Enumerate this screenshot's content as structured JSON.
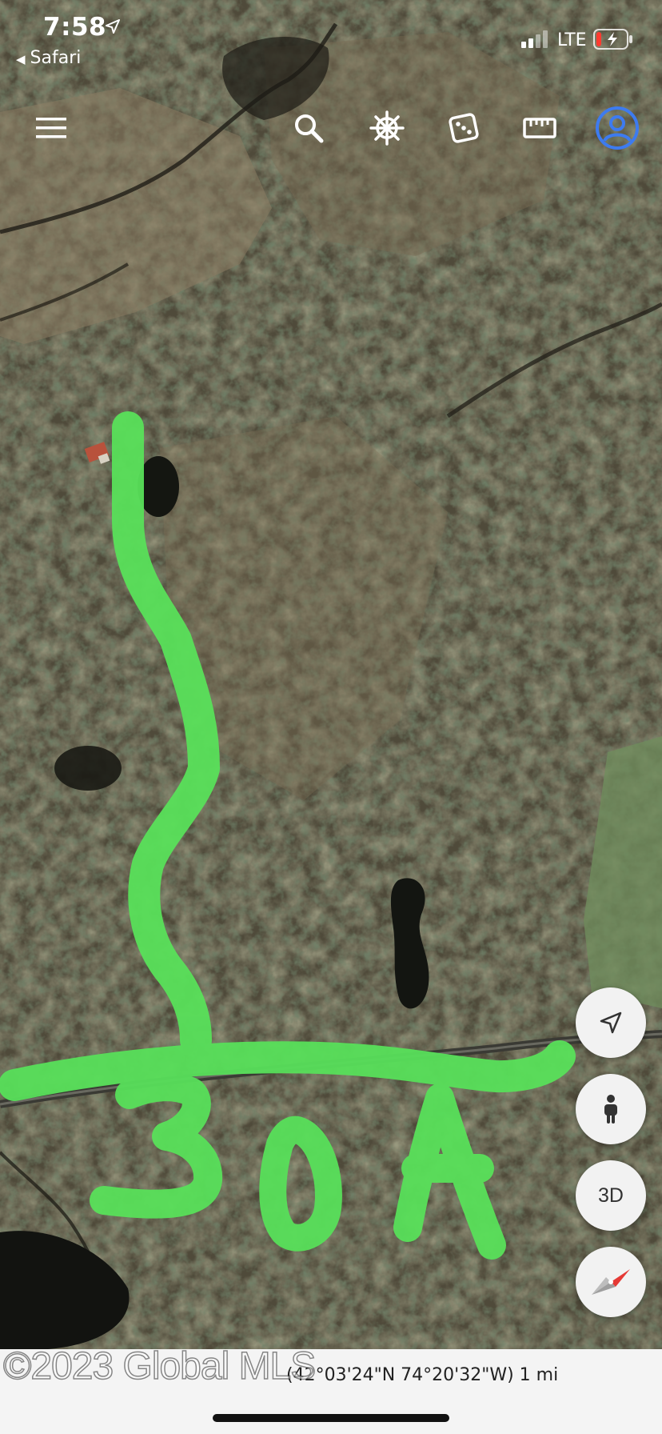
{
  "status_bar": {
    "time": "7:58",
    "back_app": "Safari",
    "network": "LTE"
  },
  "toolbar": {
    "menu": "menu-icon",
    "search": "search-icon",
    "helm": "ship-wheel-icon",
    "dice": "dice-icon",
    "ruler": "ruler-icon",
    "profile": "account-icon"
  },
  "map": {
    "type": "satellite",
    "route_color": "#58e05a",
    "annotation_text": "30A"
  },
  "controls": {
    "location": "navigation-arrow-icon",
    "street_view": "pegman-icon",
    "view_3d_label": "3D",
    "compass": "compass-icon"
  },
  "footer": {
    "attribution": "(42°03'24\"N 74°20'32\"W) 1 mi",
    "watermark": "©2023 Global MLS"
  }
}
